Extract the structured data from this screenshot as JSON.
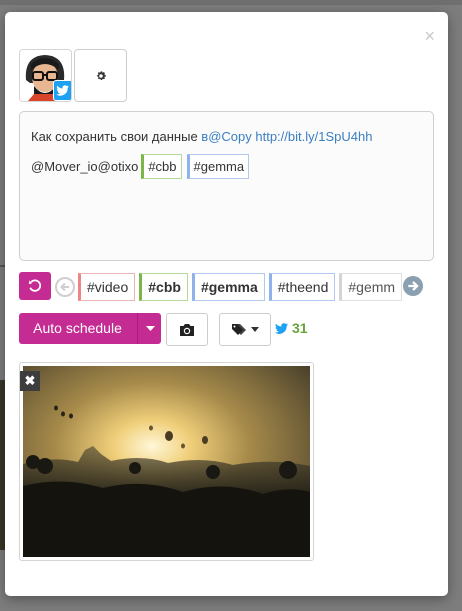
{
  "modal": {
    "close_glyph": "×"
  },
  "profile": {
    "avatar_icon": "avatar-with-twitter-badge",
    "settings_icon": "gear-icon"
  },
  "editor": {
    "line1_text": "Как сохранить свои данные ",
    "line1_link1": "в@Copy",
    "line1_link2": "http://bit.ly/1SpU4hh",
    "line2_text": "@Mover_io@otixo",
    "line2_tags": [
      "#cbb",
      "#gemma"
    ]
  },
  "tagbar": {
    "tags": [
      "#video",
      "#cbb",
      "#gemma",
      "#theend",
      "#gemm"
    ]
  },
  "actions": {
    "auto_schedule_label": "Auto schedule",
    "twitter_count": "31"
  },
  "attachment": {
    "remove_glyph": "✖"
  },
  "colors": {
    "accent": "#c42b93",
    "link": "#3b7ec2",
    "twitter": "#1da1f2",
    "count_green": "#6aa33a"
  }
}
